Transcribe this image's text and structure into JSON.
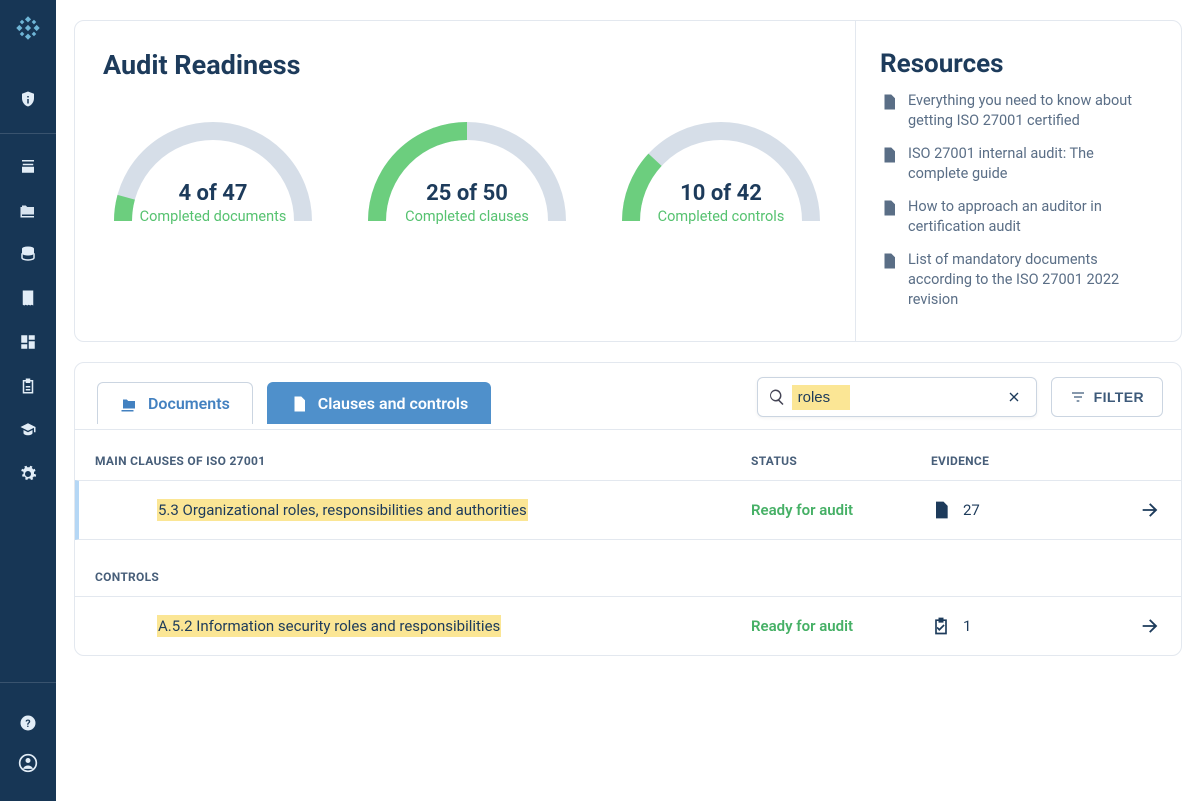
{
  "header": {
    "title": "Audit Readiness"
  },
  "gauges": [
    {
      "count_text": "4 of 47",
      "label": "Completed  documents",
      "percent": 0.085
    },
    {
      "count_text": "25 of 50",
      "label": "Completed clauses",
      "percent": 0.5
    },
    {
      "count_text": "10 of 42",
      "label": "Completed controls",
      "percent": 0.238
    }
  ],
  "resources": {
    "title": "Resources",
    "items": [
      "Everything you need to know about getting ISO 27001 certified",
      "ISO 27001 internal audit: The complete guide",
      "How to approach an auditor in certification audit",
      "List of mandatory documents according to the ISO 27001 2022 revision"
    ]
  },
  "tabs": {
    "documents": "Documents",
    "clauses": "Clauses and controls"
  },
  "search": {
    "value": "roles"
  },
  "filter_label": "FILTER",
  "sections": {
    "main_clauses": {
      "heading": "MAIN CLAUSES OF ISO 27001",
      "status_col": "STATUS",
      "evidence_col": "EVIDENCE",
      "row": {
        "name": "5.3 Organizational roles, responsibilities and authorities",
        "status": "Ready for audit",
        "evidence_count": "27",
        "evidence_kind": "file"
      }
    },
    "controls": {
      "heading": "CONTROLS",
      "row": {
        "name": "A.5.2 Information security roles and responsibilities",
        "status": "Ready for audit",
        "evidence_count": "1",
        "evidence_kind": "task"
      }
    }
  },
  "colors": {
    "sidebar": "#173655",
    "accent": "#4f90cb",
    "green": "#56c270"
  }
}
